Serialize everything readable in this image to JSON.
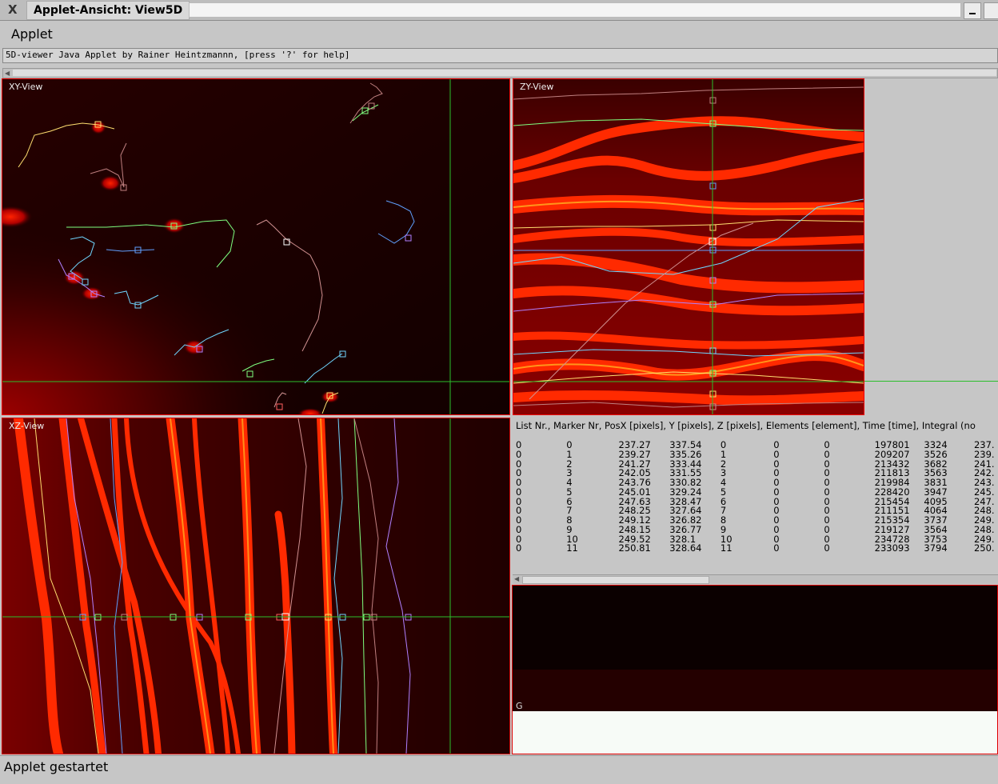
{
  "window": {
    "title": "Applet-Ansicht: View5D",
    "close_glyph": "X"
  },
  "menu": {
    "applet_label": "Applet"
  },
  "info": {
    "text": "5D-viewer Java Applet by Rainer Heintzmannn, [press '?' for help]"
  },
  "views": {
    "xy_label": "XY-View",
    "zy_label": "ZY-View",
    "xz_label": "XZ-View"
  },
  "table": {
    "header": "List Nr., Marker Nr, PosX [pixels], Y [pixels], Z [pixels], Elements [element], Time [time], Integral (no",
    "rows": [
      [
        "0",
        "0",
        "237.27",
        "337.54",
        "0",
        "0",
        "0",
        "197801",
        "3324",
        "237."
      ],
      [
        "0",
        "1",
        "239.27",
        "335.26",
        "1",
        "0",
        "0",
        "209207",
        "3526",
        "239."
      ],
      [
        "0",
        "2",
        "241.27",
        "333.44",
        "2",
        "0",
        "0",
        "213432",
        "3682",
        "241."
      ],
      [
        "0",
        "3",
        "242.05",
        "331.55",
        "3",
        "0",
        "0",
        "211813",
        "3563",
        "242."
      ],
      [
        "0",
        "4",
        "243.76",
        "330.82",
        "4",
        "0",
        "0",
        "219984",
        "3831",
        "243."
      ],
      [
        "0",
        "5",
        "245.01",
        "329.24",
        "5",
        "0",
        "0",
        "228420",
        "3947",
        "245."
      ],
      [
        "0",
        "6",
        "247.63",
        "328.47",
        "6",
        "0",
        "0",
        "215454",
        "4095",
        "247."
      ],
      [
        "0",
        "7",
        "248.25",
        "327.64",
        "7",
        "0",
        "0",
        "211151",
        "4064",
        "248."
      ],
      [
        "0",
        "8",
        "249.12",
        "326.82",
        "8",
        "0",
        "0",
        "215354",
        "3737",
        "249."
      ],
      [
        "0",
        "9",
        "248.15",
        "326.77",
        "9",
        "0",
        "0",
        "219127",
        "3564",
        "248."
      ],
      [
        "0",
        "10",
        "249.52",
        "328.1",
        "10",
        "0",
        "0",
        "234728",
        "3753",
        "249."
      ],
      [
        "0",
        "11",
        "250.81",
        "328.64",
        "11",
        "0",
        "0",
        "233093",
        "3794",
        "250."
      ]
    ]
  },
  "plot": {
    "label": "G"
  },
  "status": {
    "text": "Applet gestartet"
  },
  "colors": {
    "crosshair": "#2cbf2c",
    "view_border": "#e00000",
    "image_dark": "#1a0000",
    "image_bright": "#ff2a00",
    "track_colors": [
      "#7fff7f",
      "#ff8080",
      "#6fd6ff",
      "#ffdf70",
      "#b080ff",
      "#c08080",
      "#60a0ff"
    ]
  }
}
